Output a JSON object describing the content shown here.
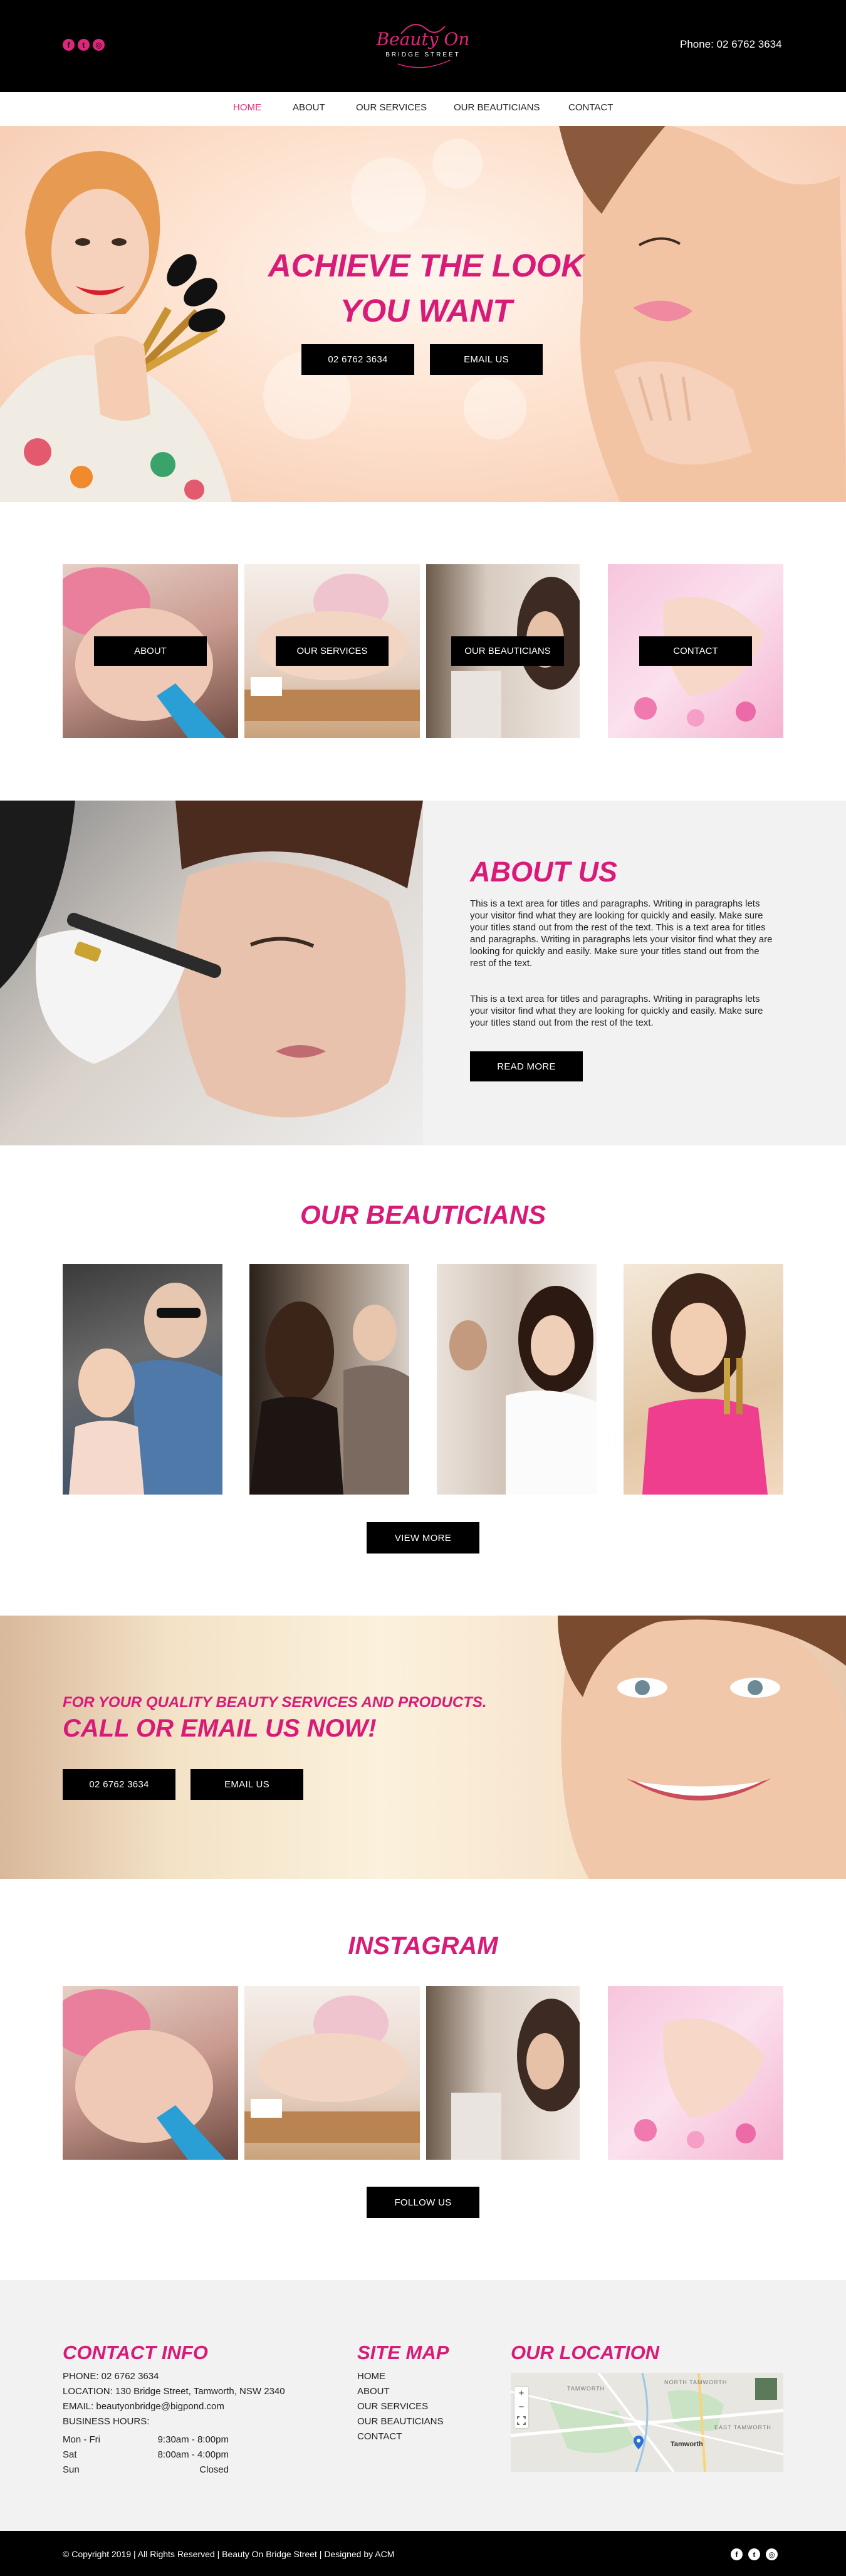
{
  "header": {
    "phone": "Phone: 02 6762 3634",
    "logo_script": "Beauty On",
    "logo_sub": "BRIDGE STREET",
    "social": [
      {
        "name": "facebook-icon",
        "glyph": "f"
      },
      {
        "name": "twitter-icon",
        "glyph": "t"
      },
      {
        "name": "instagram-icon",
        "glyph": "◎"
      }
    ]
  },
  "nav": {
    "items": [
      "HOME",
      "ABOUT",
      "OUR SERVICES",
      "OUR BEAUTICIANS",
      "CONTACT"
    ],
    "active": "HOME"
  },
  "hero": {
    "title_line1": "ACHIEVE THE LOOK",
    "title_line2": "YOU WANT",
    "phone_button": "02 6762 3634",
    "email_button": "EMAIL US"
  },
  "tiles": [
    "ABOUT",
    "OUR SERVICES",
    "OUR BEAUTICIANS",
    "CONTACT"
  ],
  "about": {
    "title": "ABOUT US",
    "para1": "This is a text area for titles and paragraphs. Writing in paragraphs lets your visitor find what they are looking for quickly and easily. Make sure your titles stand out from the rest of the text. This is a text area for titles and paragraphs. Writing in paragraphs lets your visitor find what they are looking for quickly and easily. Make sure your titles stand out from the rest of the text.",
    "para2": "This is a text area for titles and paragraphs. Writing in paragraphs lets your visitor find what they are looking for quickly and easily. Make sure your titles stand out from the rest of the text.",
    "button": "READ MORE"
  },
  "beauticians": {
    "title": "OUR BEAUTICIANS",
    "button": "VIEW MORE"
  },
  "cta": {
    "subtitle": "FOR YOUR QUALITY BEAUTY SERVICES AND PRODUCTS.",
    "title": "CALL OR EMAIL US NOW!",
    "phone_button": "02 6762 3634",
    "email_button": "EMAIL US"
  },
  "instagram": {
    "title": "INSTAGRAM",
    "button": "FOLLOW  US"
  },
  "footer": {
    "contact_title": "CONTACT INFO",
    "phone": "PHONE: 02 6762 3634",
    "location": "LOCATION: 130 Bridge Street, Tamworth, NSW 2340",
    "email": "EMAIL: beautyonbridge@bigpond.com",
    "hours_label": "BUSINESS HOURS:",
    "hours": [
      {
        "day": "Mon - Fri",
        "time": "9:30am - 8:00pm"
      },
      {
        "day": "Sat",
        "time": "8:00am - 4:00pm"
      },
      {
        "day": "Sun",
        "time": "Closed"
      }
    ],
    "sitemap_title": "SITE MAP",
    "sitemap": [
      "HOME",
      "ABOUT",
      "OUR SERVICES",
      "OUR BEAUTICIANS",
      "CONTACT"
    ],
    "location_title": "OUR LOCATION",
    "map_label": "Tamworth",
    "map_north": "NORTH TAMWORTH",
    "map_east": "EAST TAMWORTH",
    "map_town": "TAMWORTH",
    "map_zoom_in": "+",
    "map_zoom_out": "−",
    "copyright": "© Copyright 2019 | All Rights Reserved | Beauty On Bridge Street | Designed by ACM"
  },
  "colors": {
    "accent": "#d81b78",
    "dark": "#000000",
    "light_bg": "#f2f2f2"
  }
}
